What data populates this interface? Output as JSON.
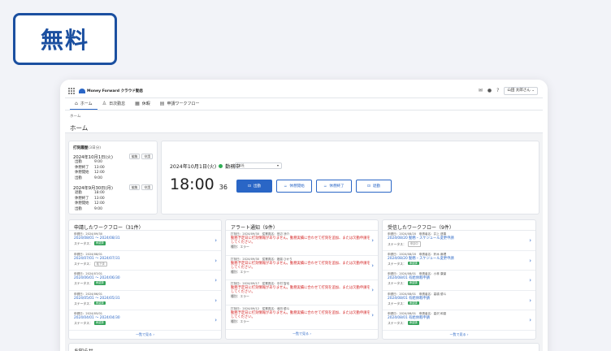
{
  "promo": {
    "badge": "無料"
  },
  "app": {
    "brand": "Money Forward クラウド勤怠",
    "user_menu": "山田 太郎さん",
    "user_caret": "⌄",
    "nav": [
      {
        "label": "ホーム",
        "icon": "home-icon"
      },
      {
        "label": "日次勤怠",
        "icon": "person-icon"
      },
      {
        "label": "休暇",
        "icon": "calendar-icon"
      },
      {
        "label": "申請ワークフロー",
        "icon": "workflow-icon"
      }
    ],
    "breadcrumb": "ホーム",
    "page_title": "ホーム"
  },
  "stamp_history": {
    "title": "打刻履歴",
    "period": "(3日分)",
    "edit_label": "編集",
    "request_label": "申請",
    "days": [
      {
        "date": "2024年10月1日(火)",
        "rows": [
          {
            "k": "出勤",
            "v": "9:00"
          },
          {
            "k": "休憩終了",
            "v": "13:00"
          },
          {
            "k": "休憩開始",
            "v": "12:00"
          },
          {
            "k": "出勤",
            "v": "9:00"
          }
        ]
      },
      {
        "date": "2024年9月30日(月)",
        "rows": [
          {
            "k": "退勤",
            "v": "18:00"
          },
          {
            "k": "休憩終了",
            "v": "13:00"
          },
          {
            "k": "休憩開始",
            "v": "12:00"
          },
          {
            "k": "出勤",
            "v": "9:00"
          }
        ]
      }
    ]
  },
  "clock": {
    "date": "2024年10月1日(火)",
    "status": "勤務中",
    "location_select": "本社",
    "time": "18:00",
    "seconds": "36",
    "buttons": {
      "clock_in": "出勤",
      "break_start": "休憩開始",
      "break_end": "休憩終了",
      "clock_out": "退勤"
    }
  },
  "workflow_panel": {
    "title": "申請したワークフロー（31件）",
    "status_label": "ステータス：",
    "entries": [
      {
        "meta": "申請日：2024/09/30",
        "period": "2024/08/01 ～ 2024/08/31",
        "status": "承認済",
        "status_kind": "approved"
      },
      {
        "meta": "申請日：2024/08/01",
        "period": "2024/07/01 ～ 2024/07/31",
        "status": "取下済",
        "status_kind": "neutral"
      },
      {
        "meta": "申請日：2024/07/01",
        "period": "2024/06/01 ～ 2024/06/30",
        "status": "承認済",
        "status_kind": "approved"
      },
      {
        "meta": "申請日：2024/06/01",
        "period": "2024/05/01 ～ 2024/05/31",
        "status": "承認済",
        "status_kind": "approved"
      },
      {
        "meta": "申請日：2024/05/01",
        "period": "2024/04/01 ～ 2024/04/30",
        "status": "承認済",
        "status_kind": "approved"
      }
    ],
    "more": "一覧で見る ›"
  },
  "alert_panel": {
    "title": "アラート通知（9件）",
    "entries": [
      {
        "meta": "打刻日：2024/09/30　従業員名：田辺 涼介",
        "message": "勤務予定日に打刻情報がありません。勤務実績に合わせて打刻を追加、または欠勤申請をしてください。",
        "type": "種別：エラー"
      },
      {
        "meta": "打刻日：2024/09/30　従業員名：渡邉 ひかり",
        "message": "勤務予定日に打刻情報がありません。勤務実績に合わせて打刻を追加、または欠勤申請をしてください。",
        "type": "種別：エラー"
      },
      {
        "meta": "打刻日：2024/09/17　従業員名：中村 智也",
        "message": "勤務予定日に打刻情報がありません。勤務実績に合わせて打刻を追加、または欠勤申請をしてください。",
        "type": "種別：エラー"
      },
      {
        "meta": "打刻日：2024/09/12　従業員名：池田 優斗",
        "message": "勤務予定日に打刻情報がありません。勤務実績に合わせて打刻を追加、または欠勤申請をしてください。",
        "type": "種別：エラー"
      }
    ],
    "more": "一覧で見る ›"
  },
  "received_panel": {
    "title": "受信したワークフロー（9件）",
    "status_label": "ステータス：",
    "entries": [
      {
        "meta": "申請日：2024/08/20　申請者名：井上 啓喜",
        "subject": "2024/08/20 勤務・スケジュール変更申請",
        "status": "申請中",
        "status_kind": "neutral"
      },
      {
        "meta": "申請日：2024/08/20　申請者名：鈴木 麻理",
        "subject": "2024/08/20 勤務・スケジュール変更申請",
        "status": "承認済",
        "status_kind": "approved"
      },
      {
        "meta": "申請日：2024/08/01　申請者名：小林 康豪",
        "subject": "2024/08/01 有給休暇申請",
        "status": "承認済",
        "status_kind": "approved"
      },
      {
        "meta": "申請日：2024/08/01　申請者名：高橋 優斗",
        "subject": "2024/08/01 有給休暇申請",
        "status": "承認済",
        "status_kind": "approved"
      },
      {
        "meta": "申請日：2024/08/01　申請者名：高沢 和香",
        "subject": "2024/08/01 有給休暇申請",
        "status": "承認済",
        "status_kind": "approved"
      }
    ],
    "more": "一覧で見る ›"
  },
  "notice": {
    "title": "お知らせ"
  },
  "colors": {
    "accent": "#2a66c6",
    "badge": "#1b4fa0",
    "alert": "#d32020",
    "approved": "#35a35a"
  }
}
